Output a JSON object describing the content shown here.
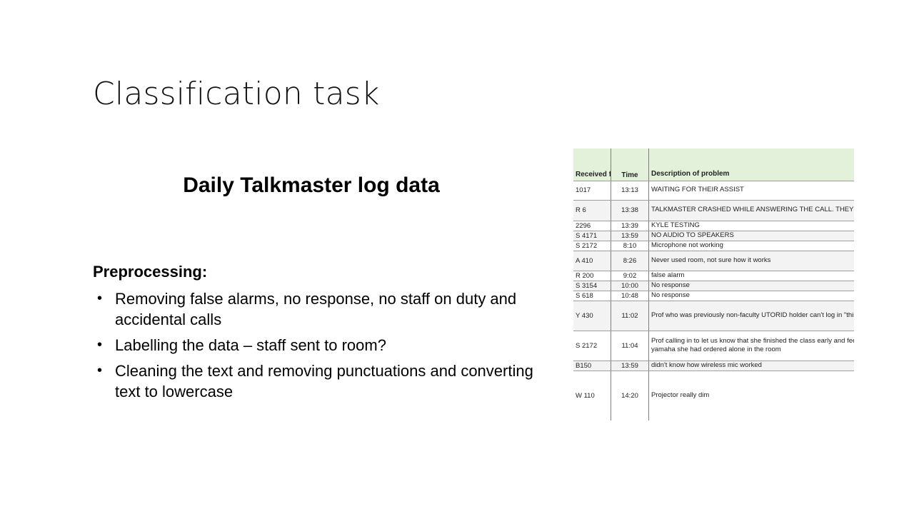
{
  "slide": {
    "title": "Classification task",
    "subtitle": "Daily Talkmaster log data",
    "preprocessing_heading": "Preprocessing:",
    "bullets": [
      "Removing false alarms, no response, no staff on duty and accidental calls",
      "Labelling the data – staff sent to room?",
      "Cleaning the text and removing punctuations and converting text to lowercase"
    ]
  },
  "table": {
    "header_fill": "#e3f0da",
    "columns": [
      "Received from:",
      "Time",
      "Description of problem"
    ],
    "rows": [
      {
        "room": "1017",
        "time": "13:13",
        "desc": "WAITING FOR THEIR ASSIST",
        "h": 27
      },
      {
        "room": "R 6",
        "time": "13:38",
        "desc": "TALKMASTER CRASHED WHILE ANSWERING THE CALL. THEY DIDN'T CALL BACK.",
        "h": 29
      },
      {
        "room": "2296",
        "time": "13:39",
        "desc": "KYLE TESTING",
        "h": 14
      },
      {
        "room": "S 4171",
        "time": "13:59",
        "desc": "NO AUDIO TO SPEAKERS",
        "h": 14
      },
      {
        "room": "S 2172",
        "time": "8:10",
        "desc": "Microphone not working",
        "h": 14
      },
      {
        "room": "A 410",
        "time": "8:26",
        "desc": "Never used room, not sure how it works",
        "h": 28
      },
      {
        "room": "R 200",
        "time": "9:02",
        "desc": "false alarm",
        "h": 14
      },
      {
        "room": "S 3154",
        "time": "10:00",
        "desc": "No response",
        "h": 14
      },
      {
        "room": "S 618",
        "time": "10:48",
        "desc": "No response",
        "h": 14
      },
      {
        "room": "Y 430",
        "time": "11:02",
        "desc": "Prof who was previously non-faculty UTORID holder can't log in \"this is a recurring issue for me\"",
        "h": 42
      },
      {
        "room": "S 2172",
        "time": "11:04",
        "desc": "Prof calling in to let us know that she finished the class early and feels uncomfortable leaving the yamaha she had ordered alone in the room",
        "h": 42
      },
      {
        "room": "B150",
        "time": "13:59",
        "desc": "didn't know how wireless mic worked",
        "h": 14
      },
      {
        "room": "W 110",
        "time": "14:20",
        "desc": "Projector really dim",
        "h": 70
      }
    ]
  }
}
